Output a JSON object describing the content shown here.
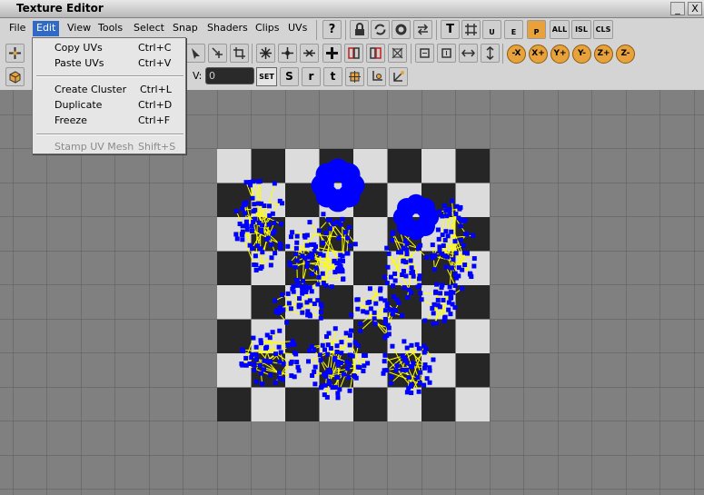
{
  "window": {
    "title": "Texture Editor",
    "min_glyph": "_",
    "close_glyph": "X"
  },
  "menubar": {
    "items": [
      {
        "id": "file",
        "label": "File"
      },
      {
        "id": "edit",
        "label": "Edit"
      },
      {
        "id": "view",
        "label": "View"
      },
      {
        "id": "tools",
        "label": "Tools"
      },
      {
        "id": "select",
        "label": "Select"
      },
      {
        "id": "snap",
        "label": "Snap"
      },
      {
        "id": "shaders",
        "label": "Shaders"
      },
      {
        "id": "clips",
        "label": "Clips"
      },
      {
        "id": "uvs",
        "label": "UVs"
      }
    ]
  },
  "edit_menu": {
    "copy_uvs": {
      "label": "Copy UVs",
      "shortcut": "Ctrl+C"
    },
    "paste_uvs": {
      "label": "Paste UVs",
      "shortcut": "Ctrl+V"
    },
    "create_cluster": {
      "label": "Create Cluster",
      "shortcut": "Ctrl+L"
    },
    "duplicate": {
      "label": "Duplicate",
      "shortcut": "Ctrl+D"
    },
    "freeze": {
      "label": "Freeze",
      "shortcut": "Ctrl+F"
    },
    "stamp_uv_mesh": {
      "label": "Stamp UV Mesh",
      "shortcut": "Shift+S"
    }
  },
  "toolbar1": {
    "help": "?",
    "t": "T",
    "u": "U",
    "e": "E",
    "p": "P",
    "all": "ALL",
    "isl": "ISL",
    "cls": "CLS"
  },
  "toolbar2": {
    "axes": [
      "-X",
      "X+",
      "Y+",
      "Y-",
      "Z+",
      "Z-"
    ]
  },
  "toolbar3": {
    "v_label": "V:",
    "v_value": "0",
    "set_label": "SET",
    "s": "S",
    "r": "r",
    "t": "t"
  },
  "colors": {
    "accent": "#316ac5",
    "uv_points": "#0000ff",
    "uv_edges": "#ffff00",
    "checker_dark": "#262626",
    "checker_light": "#dcdcdc",
    "grid_bg": "#808080"
  }
}
